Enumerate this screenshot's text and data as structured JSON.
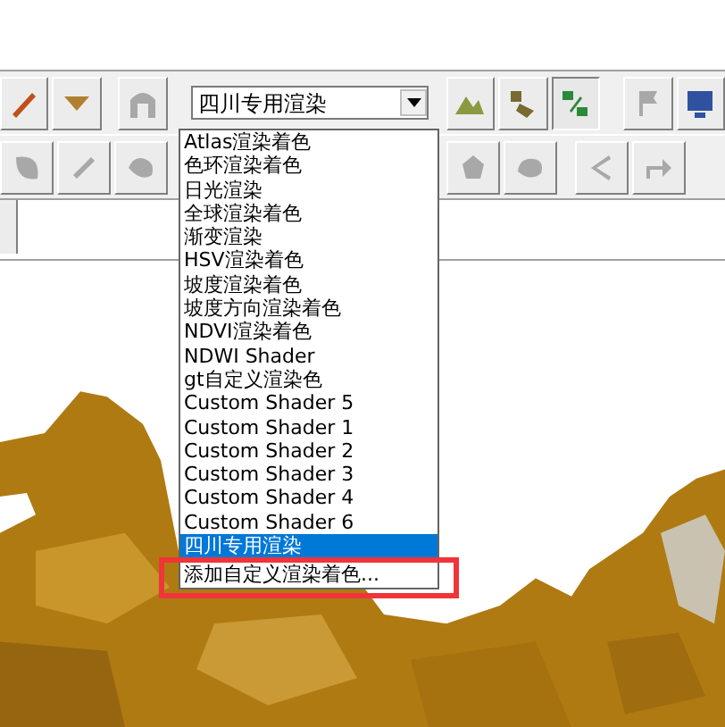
{
  "shader_combo": {
    "value": "四川专用渲染"
  },
  "shader_list": [
    {
      "label": "Atlas渲染着色",
      "selected": false
    },
    {
      "label": "色环渲染着色",
      "selected": false
    },
    {
      "label": "日光渲染",
      "selected": false
    },
    {
      "label": "全球渲染着色",
      "selected": false
    },
    {
      "label": "渐变渲染",
      "selected": false
    },
    {
      "label": "HSV渲染着色",
      "selected": false
    },
    {
      "label": "坡度渲染着色",
      "selected": false
    },
    {
      "label": "坡度方向渲染着色",
      "selected": false
    },
    {
      "label": "NDVI渲染着色",
      "selected": false
    },
    {
      "label": "NDWI Shader",
      "selected": false
    },
    {
      "label": "gt自定义渲染色",
      "selected": false
    },
    {
      "label": "Custom Shader 5",
      "selected": false
    },
    {
      "label": "Custom Shader 1",
      "selected": false
    },
    {
      "label": "Custom Shader 2",
      "selected": false
    },
    {
      "label": "Custom Shader 3",
      "selected": false
    },
    {
      "label": "Custom Shader 4",
      "selected": false
    },
    {
      "label": "Custom Shader 6",
      "selected": false
    },
    {
      "label": "四川专用渲染",
      "selected": true
    },
    {
      "label": "添加自定义渲染着色...",
      "selected": false
    }
  ]
}
